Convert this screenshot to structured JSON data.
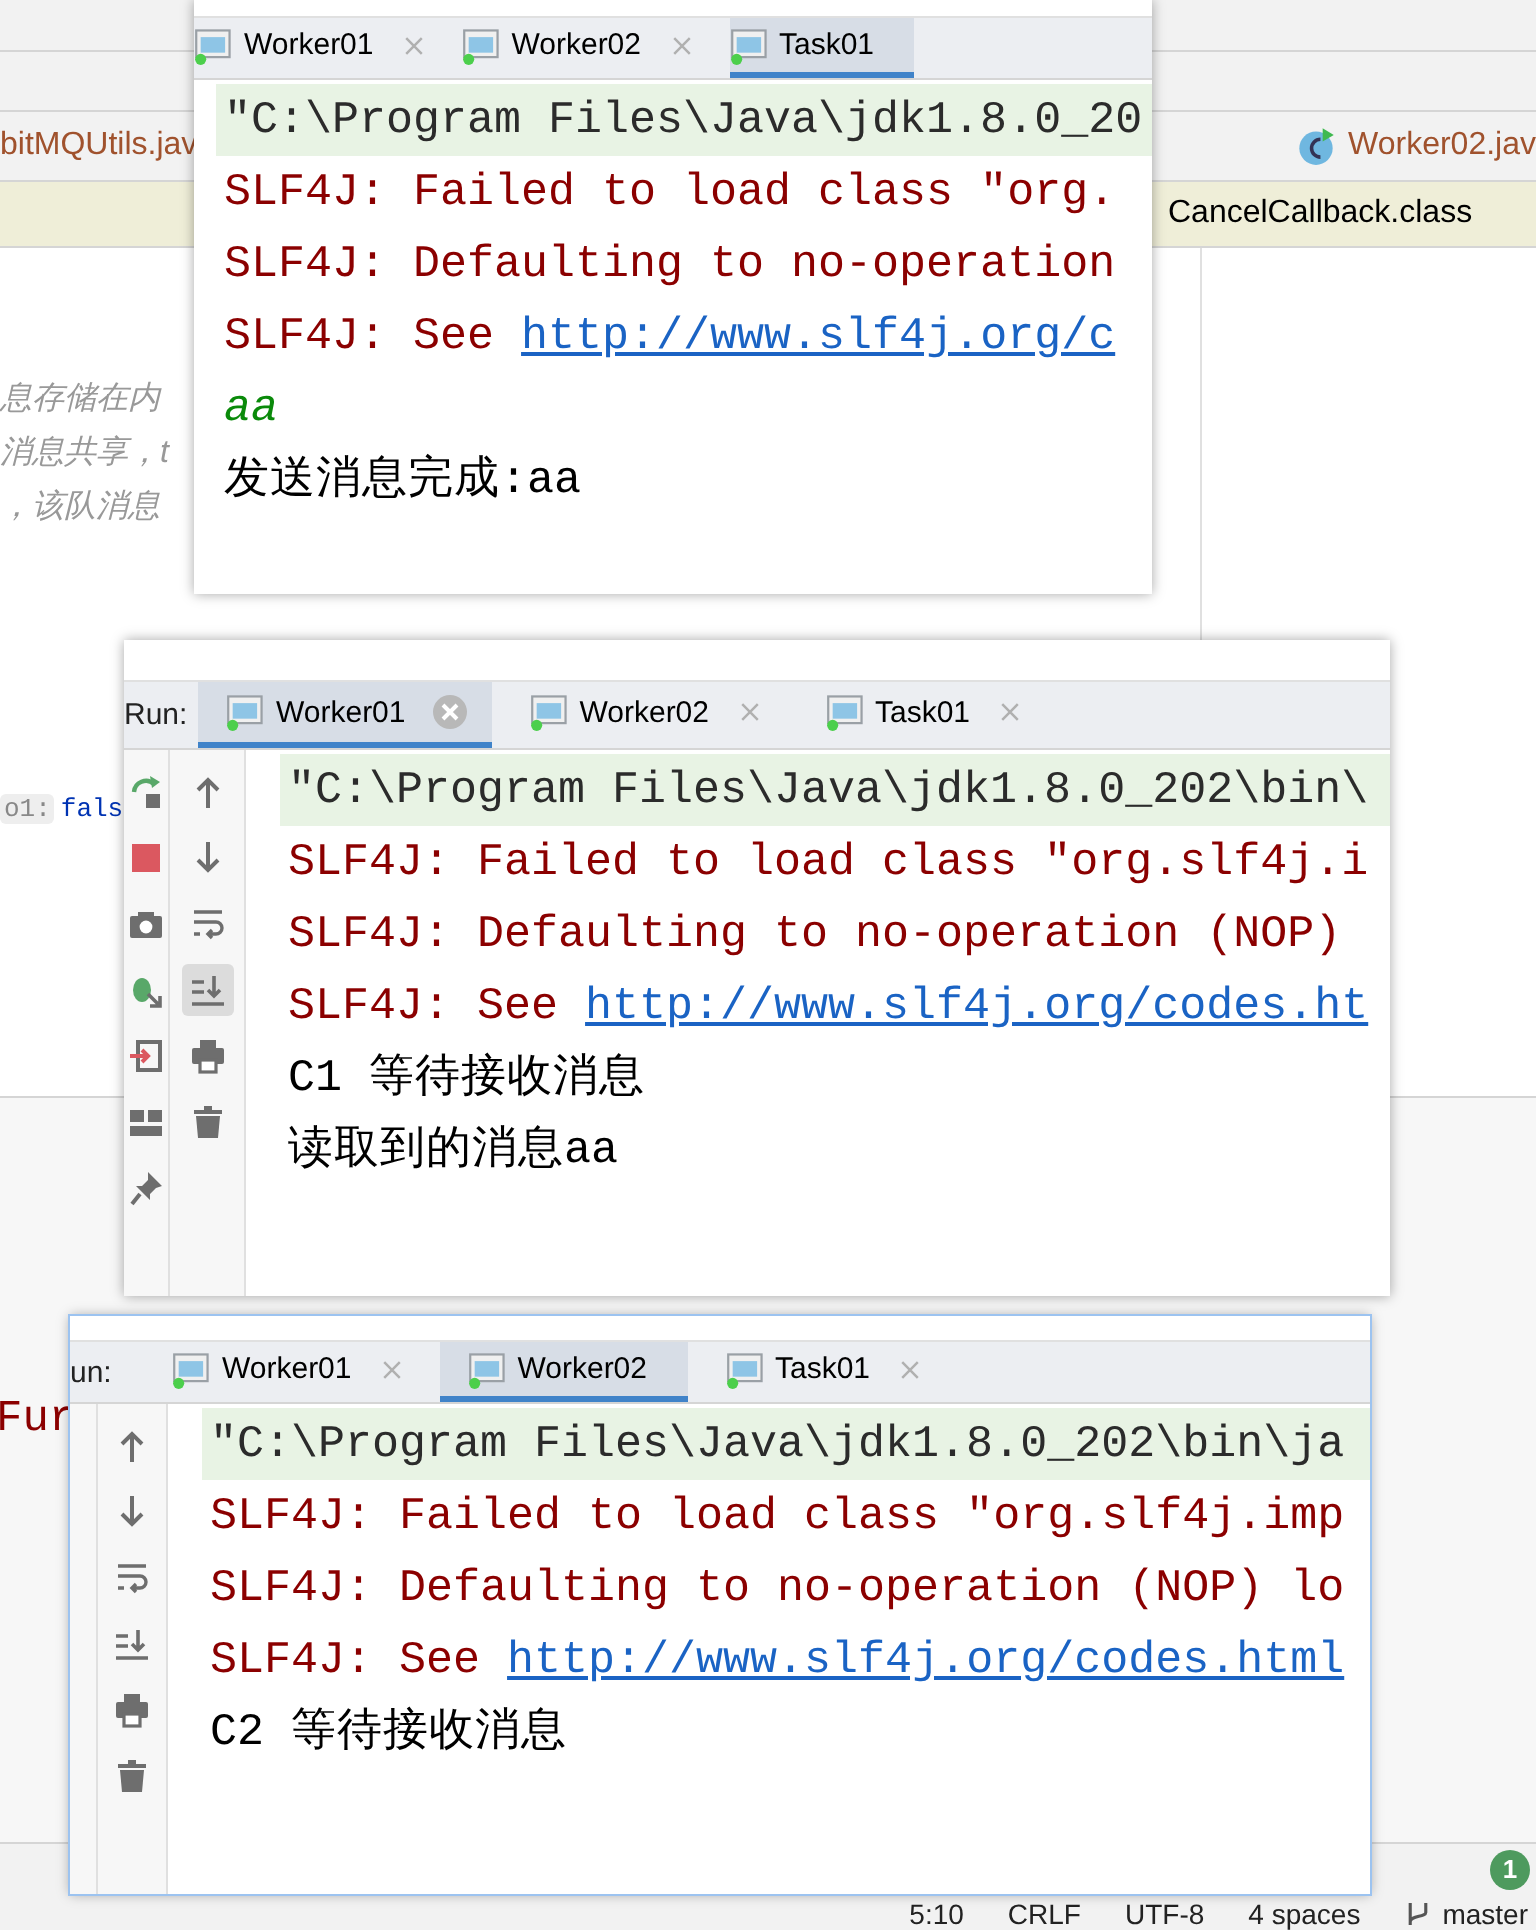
{
  "editor": {
    "file_tabs": [
      {
        "label": "bitMQUtils.jav",
        "kind": "plain"
      },
      {
        "label": "Worker02.jav",
        "kind": "class"
      }
    ],
    "class_tab": "CancelCallback.class",
    "comment_lines": [
      "息存储在内",
      "消息共享，t",
      "，该队消息"
    ],
    "code_key": "o1:",
    "code_value": "fals",
    "code_fragment": "Fur"
  },
  "run_windows": [
    {
      "tabs": [
        {
          "label": "Worker01",
          "selected": false,
          "closable": true,
          "hovered": false
        },
        {
          "label": "Worker02",
          "selected": false,
          "closable": true,
          "hovered": false
        },
        {
          "label": "Task01",
          "selected": true,
          "closable": false,
          "hovered": false
        }
      ],
      "lines": [
        {
          "kind": "command",
          "text": "\"C:\\Program Files\\Java\\jdk1.8.0_20"
        },
        {
          "kind": "error",
          "text": "SLF4J: Failed to load class \"org."
        },
        {
          "kind": "error",
          "text": "SLF4J: Defaulting to no-operation"
        },
        {
          "kind": "link",
          "text": "SLF4J: See ",
          "url": "http://www.slf4j.org/c"
        },
        {
          "kind": "echo",
          "text": "aa"
        },
        {
          "kind": "output",
          "text": "发送消息完成:aa"
        }
      ]
    },
    {
      "run_label": "Run:",
      "tabs": [
        {
          "label": "Worker01",
          "selected": true,
          "closable": true,
          "hovered": true
        },
        {
          "label": "Worker02",
          "selected": false,
          "closable": true,
          "hovered": false
        },
        {
          "label": "Task01",
          "selected": false,
          "closable": true,
          "hovered": false
        }
      ],
      "tools": [
        {
          "kind": "rerun"
        },
        {
          "kind": "stop"
        },
        {
          "kind": "camera"
        },
        {
          "kind": "debug"
        },
        {
          "kind": "exit"
        },
        {
          "kind": "layout"
        },
        {
          "kind": "pin"
        }
      ],
      "side_tools": [
        {
          "kind": "up",
          "selected": false
        },
        {
          "kind": "down",
          "selected": false
        },
        {
          "kind": "wrap",
          "selected": false
        },
        {
          "kind": "scroll-end",
          "selected": true
        },
        {
          "kind": "print",
          "selected": false
        },
        {
          "kind": "trash",
          "selected": false
        }
      ],
      "lines": [
        {
          "kind": "command",
          "text": "\"C:\\Program Files\\Java\\jdk1.8.0_202\\bin\\"
        },
        {
          "kind": "error",
          "text": "SLF4J: Failed to load class \"org.slf4j.i"
        },
        {
          "kind": "error",
          "text": "SLF4J: Defaulting to no-operation (NOP)"
        },
        {
          "kind": "link",
          "text": "SLF4J: See ",
          "url": "http://www.slf4j.org/codes.ht"
        },
        {
          "kind": "output",
          "text": "C1 等待接收消息"
        },
        {
          "kind": "output",
          "text": "读取到的消息aa"
        }
      ]
    },
    {
      "run_label": "un:",
      "tabs": [
        {
          "label": "Worker01",
          "selected": false,
          "closable": true,
          "hovered": false
        },
        {
          "label": "Worker02",
          "selected": true,
          "closable": false,
          "hovered": false
        },
        {
          "label": "Task01",
          "selected": false,
          "closable": true,
          "hovered": false
        }
      ],
      "side_tools": [
        {
          "kind": "up",
          "selected": false
        },
        {
          "kind": "down",
          "selected": false
        },
        {
          "kind": "wrap",
          "selected": false
        },
        {
          "kind": "scroll-end",
          "selected": false
        },
        {
          "kind": "print",
          "selected": false
        },
        {
          "kind": "trash",
          "selected": false
        }
      ],
      "lines": [
        {
          "kind": "command",
          "text": "\"C:\\Program Files\\Java\\jdk1.8.0_202\\bin\\ja"
        },
        {
          "kind": "error",
          "text": "SLF4J: Failed to load class \"org.slf4j.imp"
        },
        {
          "kind": "error",
          "text": "SLF4J: Defaulting to no-operation (NOP) lo"
        },
        {
          "kind": "link",
          "text": "SLF4J: See ",
          "url": "http://www.slf4j.org/codes.html"
        },
        {
          "kind": "output",
          "text": "C2 等待接收消息"
        }
      ]
    }
  ],
  "status_bar": {
    "notification_count": "1",
    "items": [
      "5:10",
      "CRLF",
      "UTF-8",
      "4 spaces"
    ],
    "branch": "master"
  }
}
